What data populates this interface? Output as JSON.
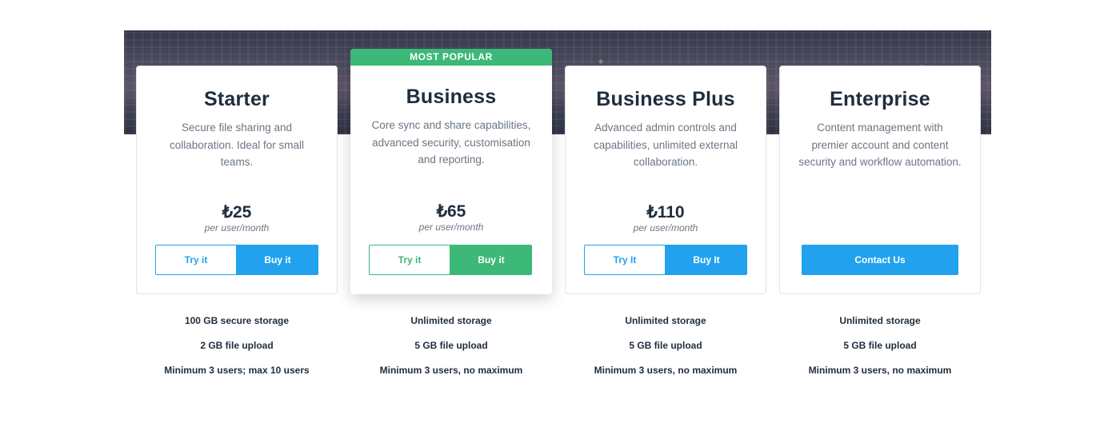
{
  "plans": [
    {
      "name": "Starter",
      "description": "Secure file sharing and collaboration. Ideal for small teams.",
      "price": "₺25",
      "per": "per user/month",
      "try_label": "Try it",
      "buy_label": "Buy it",
      "features": [
        "100 GB secure storage",
        "2 GB file upload",
        "Minimum 3 users; max 10 users"
      ]
    },
    {
      "name": "Business",
      "badge": "MOST POPULAR",
      "description": "Core sync and share capabilities, advanced security, customisation and reporting.",
      "price": "₺65",
      "per": "per user/month",
      "try_label": "Try it",
      "buy_label": "Buy it",
      "features": [
        "Unlimited storage",
        "5 GB file upload",
        "Minimum 3 users, no maximum"
      ]
    },
    {
      "name": "Business Plus",
      "description": "Advanced admin controls and capabilities, unlimited external collaboration.",
      "price": "₺110",
      "per": "per user/month",
      "try_label": "Try It",
      "buy_label": "Buy It",
      "features": [
        "Unlimited storage",
        "5 GB file upload",
        "Minimum 3 users, no maximum"
      ]
    },
    {
      "name": "Enterprise",
      "description": "Content management with premier account and content security and workflow automation.",
      "contact_label": "Contact Us",
      "features": [
        "Unlimited storage",
        "5 GB file upload",
        "Minimum 3 users, no maximum"
      ]
    }
  ],
  "colors": {
    "accent_blue": "#22a2ee",
    "accent_green": "#3cb878",
    "text_dark": "#1f2d3d",
    "text_muted": "#6b7683"
  }
}
